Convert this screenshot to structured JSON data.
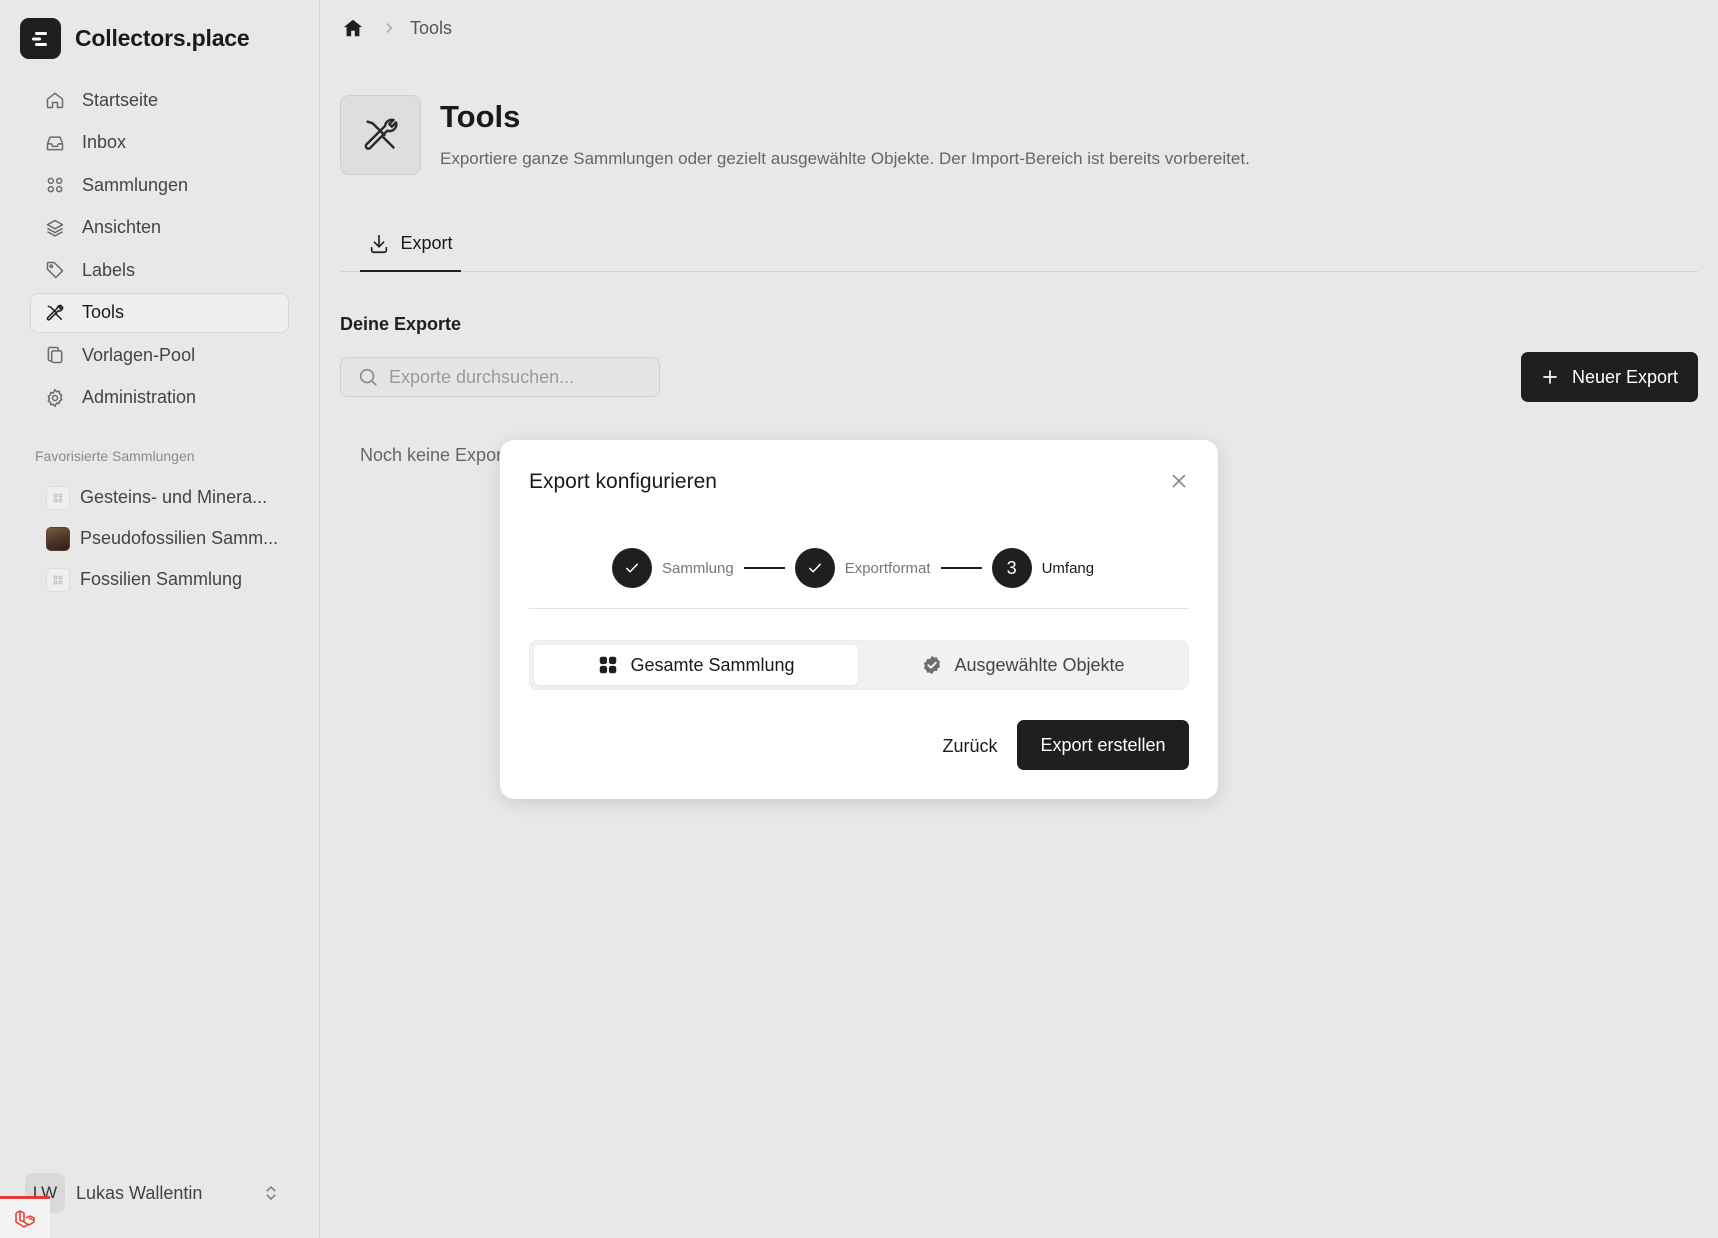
{
  "app": {
    "name": "Collectors.place"
  },
  "sidebar": {
    "items": [
      {
        "label": "Startseite",
        "icon": "home-icon"
      },
      {
        "label": "Inbox",
        "icon": "inbox-icon"
      },
      {
        "label": "Sammlungen",
        "icon": "grid-icon"
      },
      {
        "label": "Ansichten",
        "icon": "layers-icon"
      },
      {
        "label": "Labels",
        "icon": "tag-icon"
      },
      {
        "label": "Tools",
        "icon": "tools-icon",
        "active": true
      },
      {
        "label": "Vorlagen-Pool",
        "icon": "copy-icon"
      },
      {
        "label": "Administration",
        "icon": "gear-icon"
      }
    ],
    "favorites_title": "Favorisierte Sammlungen",
    "favorites": [
      {
        "label": "Gesteins- und Minera..."
      },
      {
        "label": "Pseudofossilien Samm..."
      },
      {
        "label": "Fossilien Sammlung"
      }
    ],
    "user": {
      "initials": "LW",
      "name": "Lukas Wallentin"
    }
  },
  "breadcrumb": {
    "current": "Tools"
  },
  "page": {
    "title": "Tools",
    "subtitle": "Exportiere ganze Sammlungen oder gezielt ausgewählte Objekte. Der Import-Bereich ist bereits vorbereitet."
  },
  "tabs": [
    {
      "label": "Export",
      "icon": "download-icon",
      "active": true
    }
  ],
  "exports": {
    "section_title": "Deine Exporte",
    "search_placeholder": "Exporte durchsuchen...",
    "new_button": "Neuer Export",
    "empty_text": "Noch keine Expor"
  },
  "modal": {
    "title": "Export konfigurieren",
    "steps": [
      {
        "label": "Sammlung",
        "state": "done"
      },
      {
        "label": "Exportformat",
        "state": "done"
      },
      {
        "number": "3",
        "label": "Umfang",
        "state": "current"
      }
    ],
    "options": [
      {
        "label": "Gesamte Sammlung",
        "icon": "grid-filled-icon",
        "selected": true
      },
      {
        "label": "Ausgewählte Objekte",
        "icon": "check-badge-icon",
        "selected": false
      }
    ],
    "back_button": "Zurück",
    "create_button": "Export erstellen"
  },
  "colors": {
    "primary": "#1f1f1f",
    "background": "#e8e8e8",
    "surface": "#ffffff",
    "debug_accent": "#e53935"
  }
}
